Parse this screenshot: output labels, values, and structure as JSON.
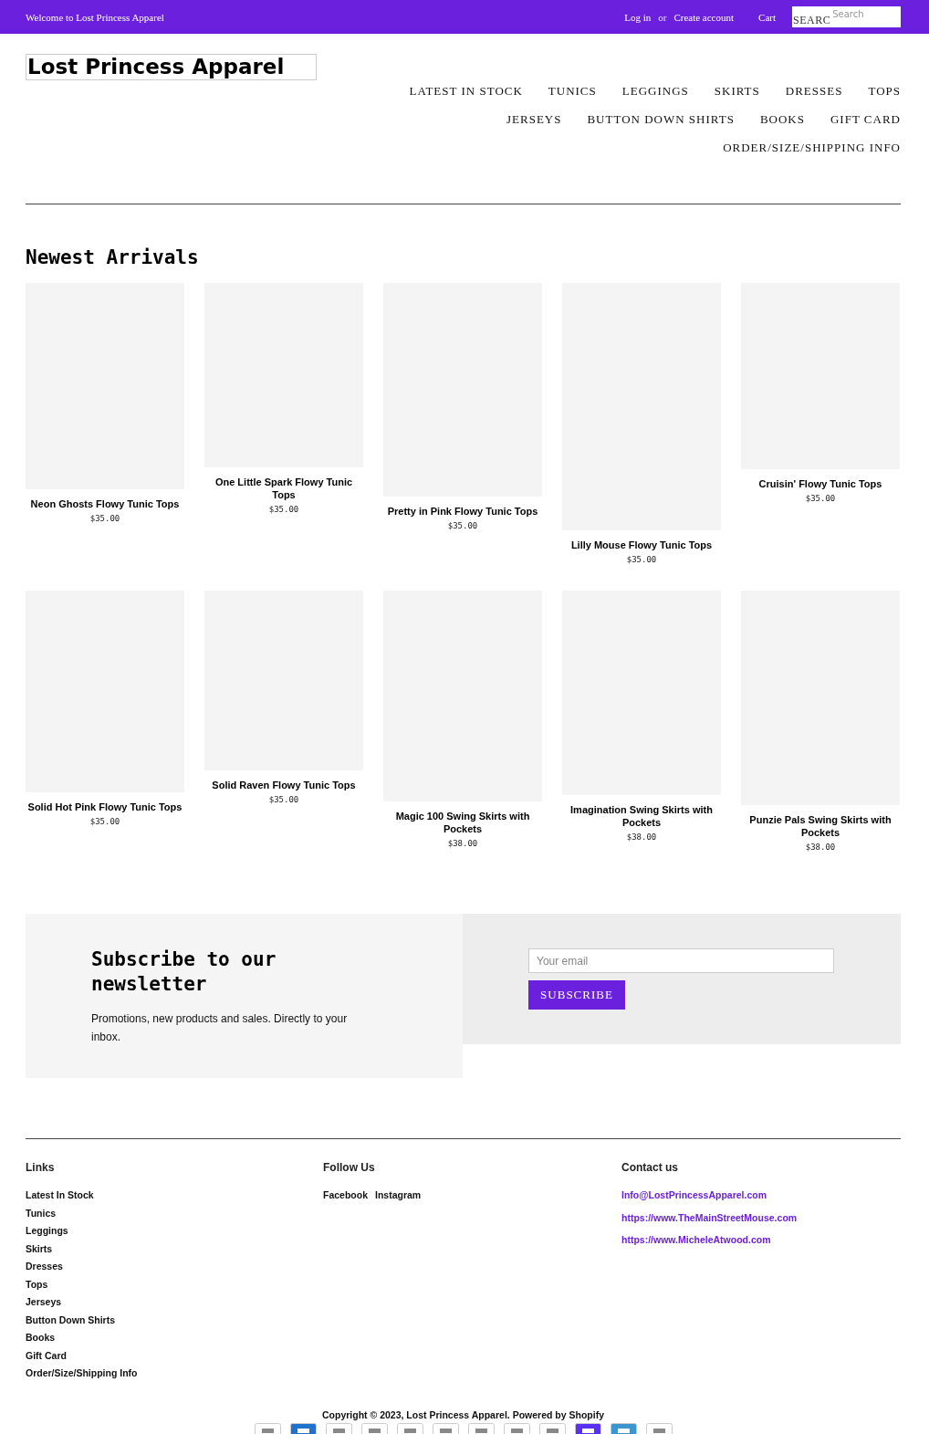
{
  "top_bar": {
    "welcome": "Welcome to Lost Princess Apparel",
    "login": "Log in",
    "or": "or",
    "create_account": "Create account",
    "cart": "Cart",
    "search": {
      "label": "SEARC",
      "placeholder": "Search"
    }
  },
  "logo": "Lost Princess Apparel",
  "nav": [
    [
      "LATEST IN STOCK",
      "TUNICS",
      "LEGGINGS",
      "SKIRTS",
      "DRESSES",
      "TOPS"
    ],
    [
      "JERSEYS",
      "BUTTON DOWN SHIRTS",
      "BOOKS",
      "GIFT CARD"
    ],
    [
      "ORDER/SIZE/SHIPPING INFO"
    ]
  ],
  "section_title": "Newest Arrivals",
  "products": [
    {
      "name": "Neon Ghosts Flowy Tunic Tops",
      "price": "$35.00"
    },
    {
      "name": "One Little Spark Flowy Tunic Tops",
      "price": "$35.00"
    },
    {
      "name": "Pretty in Pink Flowy Tunic Tops",
      "price": "$35.00"
    },
    {
      "name": "Lilly Mouse Flowy Tunic Tops",
      "price": "$35.00"
    },
    {
      "name": "Cruisin' Flowy Tunic Tops",
      "price": "$35.00"
    },
    {
      "name": "Solid Hot Pink Flowy Tunic Tops",
      "price": "$35.00"
    },
    {
      "name": "Solid Raven Flowy Tunic Tops",
      "price": "$35.00"
    },
    {
      "name": "Magic 100 Swing Skirts with Pockets",
      "price": "$38.00"
    },
    {
      "name": "Imagination Swing Skirts with Pockets",
      "price": "$38.00"
    },
    {
      "name": "Punzie Pals Swing Skirts with Pockets",
      "price": "$38.00"
    }
  ],
  "newsletter": {
    "title": "Subscribe to our newsletter",
    "text": "Promotions, new products and sales. Directly to your inbox.",
    "email_placeholder": "Your email",
    "button": "SUBSCRIBE"
  },
  "footer": {
    "columns": [
      {
        "title": "Links",
        "kind": "list",
        "items": [
          "Latest In Stock",
          "Tunics",
          "Leggings",
          "Skirts",
          "Dresses",
          "Tops",
          "Jerseys",
          "Button Down Shirts",
          "Books",
          "Gift Card",
          "Order/Size/Shipping Info"
        ]
      },
      {
        "title": "Follow Us",
        "kind": "inline",
        "items": [
          "Facebook",
          "Instagram"
        ]
      },
      {
        "title": "Contact us",
        "kind": "contact",
        "items": [
          "Info@LostPrincessApparel.com",
          "https://www.TheMainStreetMouse.com",
          "https://www.MicheleAtwood.com"
        ]
      }
    ],
    "copyright": "Copyright © 2023, Lost Princess Apparel. Powered by Shopify"
  }
}
